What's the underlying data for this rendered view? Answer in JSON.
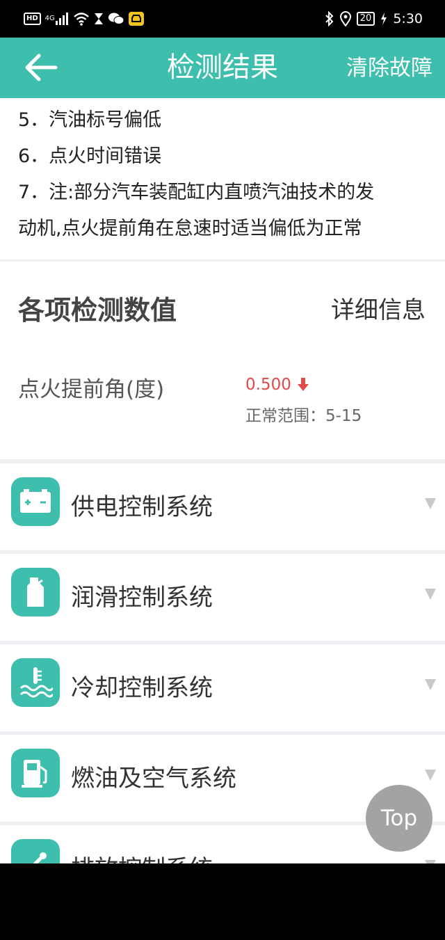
{
  "status_bar": {
    "hd": "HD",
    "network": "4G",
    "battery": "20",
    "time": "5:30"
  },
  "app_bar": {
    "title": "检测结果",
    "clear_label": "清除故障"
  },
  "notes": [
    "5．汽油标号偏低",
    "6．点火时间错误",
    "7．注:部分汽车装配缸内直喷汽油技术的发",
    "动机,点火提前角在怠速时适当偏低为正常"
  ],
  "summary": {
    "title": "各项检测数值",
    "detail_label": "详细信息",
    "param": {
      "name": "点火提前角(度)",
      "value": "0.500",
      "range": "正常范围：5-15"
    }
  },
  "systems": [
    {
      "label": "供电控制系统",
      "icon": "battery-icon"
    },
    {
      "label": "润滑控制系统",
      "icon": "oil-bottle-icon"
    },
    {
      "label": "冷却控制系统",
      "icon": "coolant-temperature-icon"
    },
    {
      "label": "燃油及空气系统",
      "icon": "fuel-pump-icon"
    },
    {
      "label": "排放控制系统",
      "icon": "exhaust-icon"
    }
  ],
  "top_button_label": "Top",
  "colors": {
    "accent": "#3ebfae",
    "alert": "#e14a4a"
  }
}
